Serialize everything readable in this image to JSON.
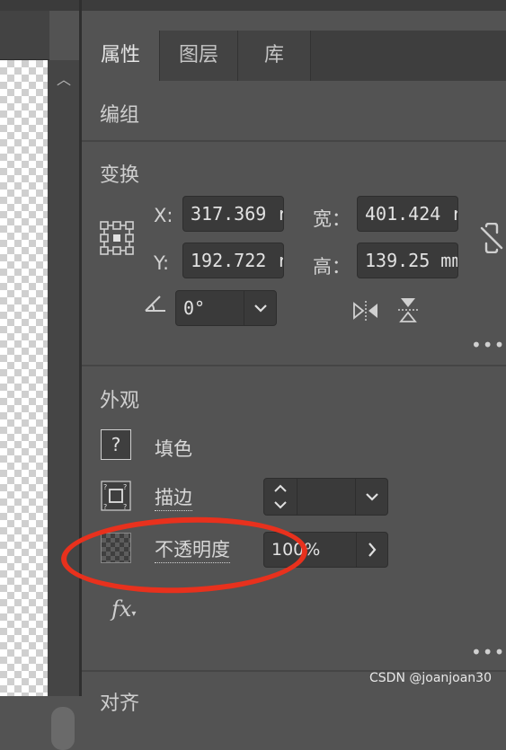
{
  "tabs": [
    {
      "label": "属性",
      "active": true
    },
    {
      "label": "图层",
      "active": false
    },
    {
      "label": "库",
      "active": false
    }
  ],
  "group_label": "编组",
  "transform": {
    "title": "变换",
    "x_label": "X:",
    "x_value": "317.369 r",
    "y_label": "Y:",
    "y_value": "192.722 r",
    "w_label": "宽：",
    "w_value": "401.424 r",
    "h_label": "高：",
    "h_value": "139.25 mm",
    "angle_value": "0°",
    "more": "•••"
  },
  "appearance": {
    "title": "外观",
    "fill_label": "填色",
    "fill_swatch": "?",
    "stroke_label": "描边",
    "opacity_label": "不透明度",
    "opacity_value": "100%",
    "fx_label": "fx",
    "more": "•••"
  },
  "next_section": "对齐",
  "watermark": "CSDN @joanjoan30",
  "colors": {
    "panel_bg": "#535353",
    "field_bg": "#3a3a3a",
    "annotation": "#e8311d"
  }
}
